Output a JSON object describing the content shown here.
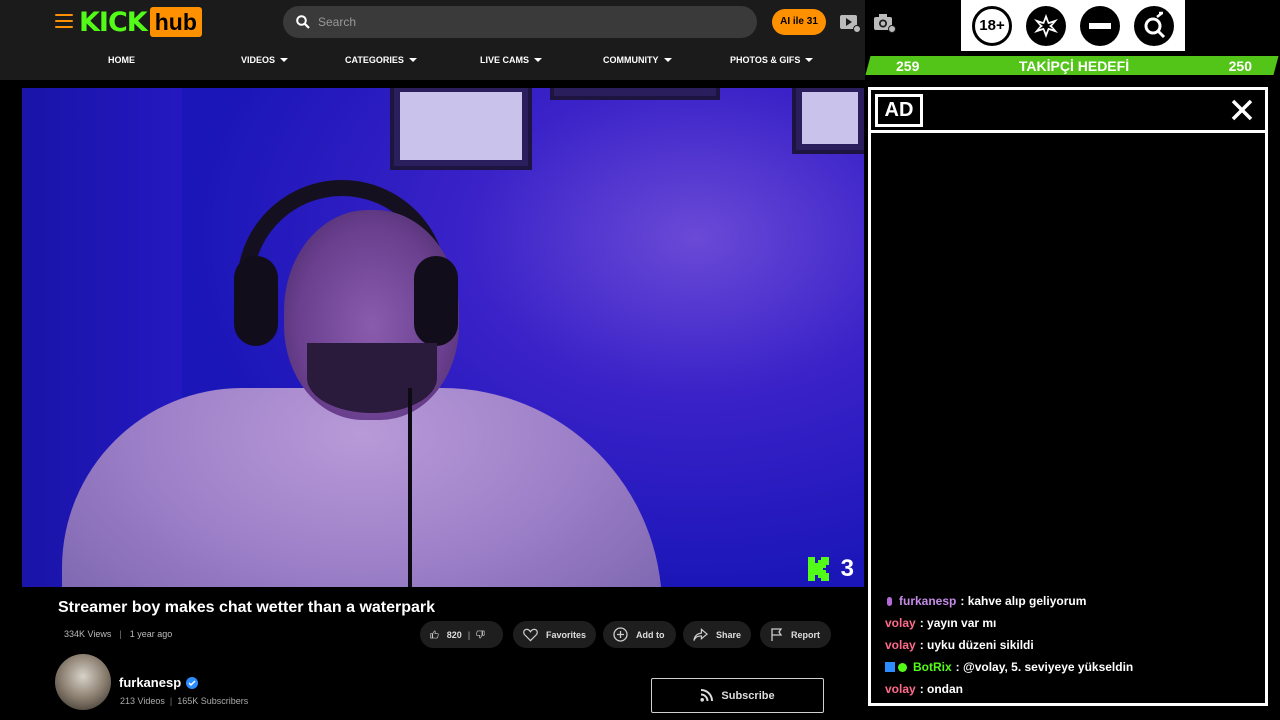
{
  "header": {
    "logo": {
      "kick": "KICK",
      "hub": "hub"
    },
    "search_placeholder": "Search",
    "ai_button": "AI ile 31",
    "nav": [
      {
        "label": "HOME",
        "caret": false
      },
      {
        "label": "VIDEOS",
        "caret": true
      },
      {
        "label": "CATEGORIES",
        "caret": true
      },
      {
        "label": "LIVE CAMS",
        "caret": true
      },
      {
        "label": "COMMUNITY",
        "caret": true
      },
      {
        "label": "PHOTOS & GIFS",
        "caret": true
      }
    ]
  },
  "badges": {
    "age": "18+",
    "icons": [
      "burst-icon",
      "no-entry-icon",
      "gender-search-icon"
    ]
  },
  "goal": {
    "current": "259",
    "label": "TAKİPÇİ HEDEFİ",
    "target": "250"
  },
  "video": {
    "overlay_number": "3"
  },
  "info": {
    "title": "Streamer boy makes chat wetter than a waterpark",
    "views": "334K Views",
    "age": "1 year ago",
    "likes": "820",
    "favorites": "Favorites",
    "add_to": "Add to",
    "share": "Share",
    "report": "Report"
  },
  "channel": {
    "name": "furkanesp",
    "videos": "213 Videos",
    "subscribers": "165K Subscribers",
    "subscribe": "Subscribe"
  },
  "ad": {
    "label": "AD"
  },
  "chat": [
    {
      "user": "furkanesp",
      "text": ": kahve alıp geliyorum",
      "color": "#c58be8",
      "icon": "mic"
    },
    {
      "user": "volay",
      "text": ": yayın var mı",
      "color": "#ff6b8a",
      "icon": ""
    },
    {
      "user": "volay",
      "text": ": uyku düzeni sikildi",
      "color": "#ff6b8a",
      "icon": ""
    },
    {
      "user": "BotRix",
      "text": ": @volay, 5. seviyeye yükseldin",
      "color": "#53fc18",
      "icon": "bot"
    },
    {
      "user": "volay",
      "text": ": ondan",
      "color": "#ff6b8a",
      "icon": ""
    }
  ],
  "colors": {
    "accent": "#ff9000",
    "kick_green": "#53fc18",
    "goal_green": "#53c418"
  }
}
